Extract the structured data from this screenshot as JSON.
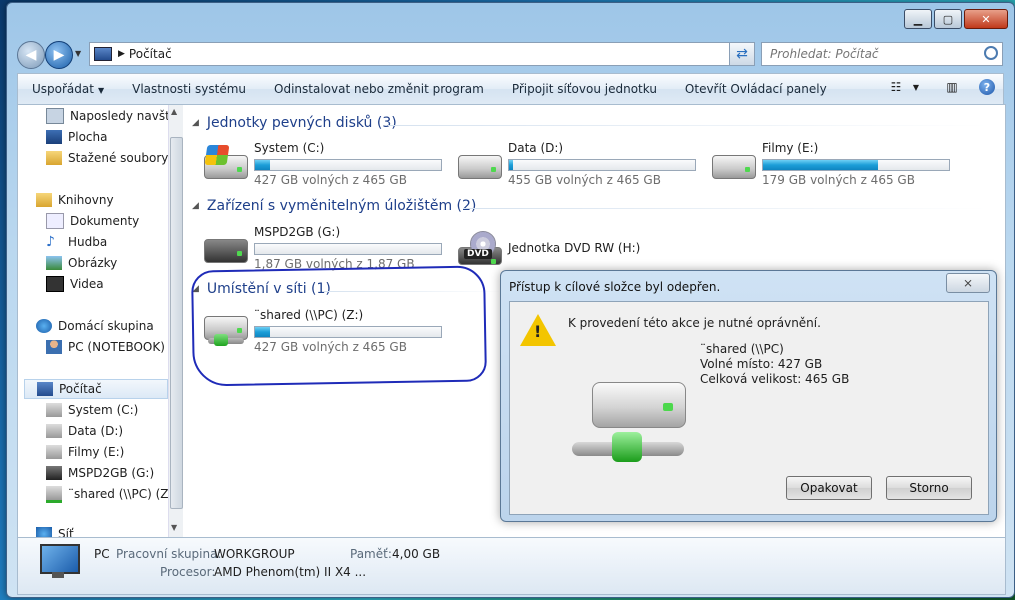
{
  "window": {
    "caption_buttons": [
      "minimize",
      "maximize",
      "close"
    ]
  },
  "address_bar": {
    "path": "Počítač",
    "search_placeholder": "Prohledat: Počítač"
  },
  "toolbar": {
    "organize": "Uspořádat",
    "system_properties": "Vlastnosti systému",
    "uninstall": "Odinstalovat nebo změnit program",
    "map_drive": "Připojit síťovou jednotku",
    "control_panel": "Otevřít Ovládací panely",
    "help": "?"
  },
  "nav": {
    "recent": "Naposledy navští",
    "desktop": "Plocha",
    "downloads": "Stažené soubory",
    "libraries": "Knihovny",
    "documents": "Dokumenty",
    "music": "Hudba",
    "pictures": "Obrázky",
    "videos": "Videa",
    "homegroup": "Domácí skupina",
    "homegroup_pc": "PC (NOTEBOOK)",
    "computer": "Počítač",
    "drive_c": "System (C:)",
    "drive_d": "Data (D:)",
    "drive_e": "Filmy (E:)",
    "drive_g": "MSPD2GB (G:)",
    "drive_z": "¨shared (\\\\PC) (Z",
    "network": "Síť"
  },
  "groups": {
    "hdd": "Jednotky pevných disků (3)",
    "removable": "Zařízení s vyměnitelným úložištěm (2)",
    "network": "Umístění v síti (1)"
  },
  "drives": {
    "c": {
      "name": "System (C:)",
      "free": "427 GB volných z 465 GB",
      "used_fraction": 0.08
    },
    "d": {
      "name": "Data (D:)",
      "free": "455 GB volných z 465 GB",
      "used_fraction": 0.02
    },
    "e": {
      "name": "Filmy (E:)",
      "free": "179 GB volných z 465 GB",
      "used_fraction": 0.62
    },
    "g": {
      "name": "MSPD2GB (G:)",
      "free": "1,87 GB volných z 1,87 GB",
      "used_fraction": 0.0
    },
    "h": {
      "name": "Jednotka DVD RW (H:)",
      "badge": "DVD"
    },
    "z": {
      "name": "¨shared (\\\\PC) (Z:)",
      "free": "427 GB volných z 465 GB",
      "used_fraction": 0.08
    }
  },
  "details": {
    "name": "PC",
    "workgroup_label": "Pracovní skupina:",
    "workgroup_value": "WORKGROUP",
    "memory_label": "Paměť:",
    "memory_value": "4,00 GB",
    "cpu_label": "Procesor:",
    "cpu_value": "AMD Phenom(tm) II X4 ..."
  },
  "dialog": {
    "title": "Přístup k cílové složce byl odepřen.",
    "close": "⨯",
    "message": "K provedení této akce je nutné oprávnění.",
    "target_name": "¨shared (\\\\PC)",
    "free_space": "Volné místo: 427 GB",
    "total_size": "Celková velikost: 465 GB",
    "retry": "Opakovat",
    "cancel": "Storno"
  }
}
